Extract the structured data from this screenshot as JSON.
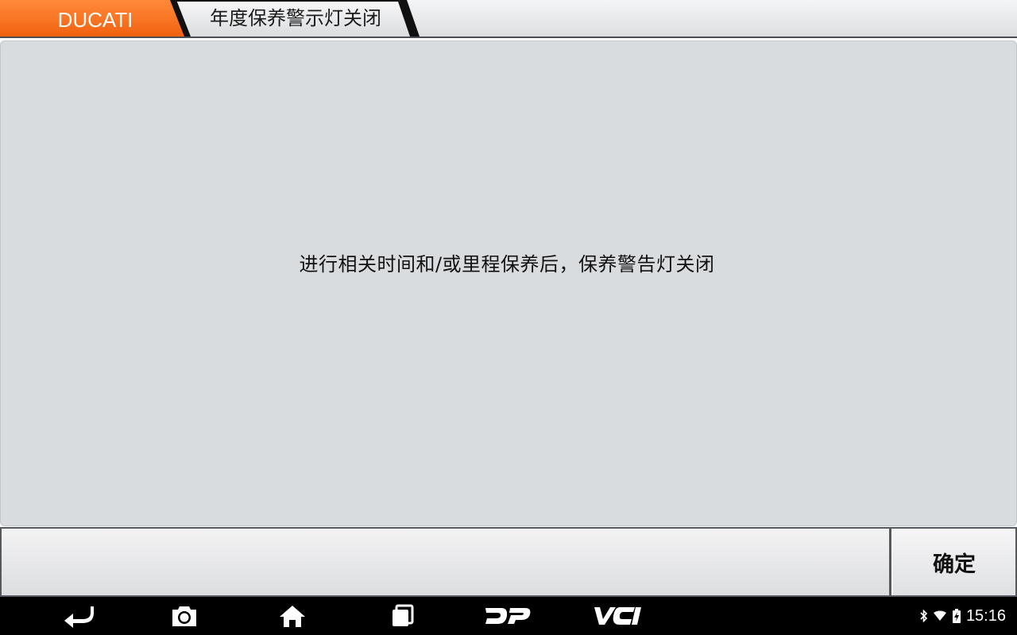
{
  "breadcrumb": {
    "brand": "DUCATI",
    "function": "年度保养警示灯关闭"
  },
  "main": {
    "message": "进行相关时间和/或里程保养后，保养警告灯关闭"
  },
  "footer": {
    "confirm_label": "确定"
  },
  "navbar": {
    "buttons": [
      "back-icon",
      "camera-icon",
      "home-icon",
      "recent-apps-icon",
      "dp-icon",
      "vci-icon"
    ],
    "dp_label": "DP",
    "vci_label": "VCI"
  },
  "status": {
    "time": "15:16",
    "icons": [
      "bluetooth-icon",
      "wifi-icon",
      "battery-icon"
    ]
  },
  "colors": {
    "brand_orange": "#f26f1b",
    "panel": "#d9dcdf",
    "navbar": "#000000"
  }
}
